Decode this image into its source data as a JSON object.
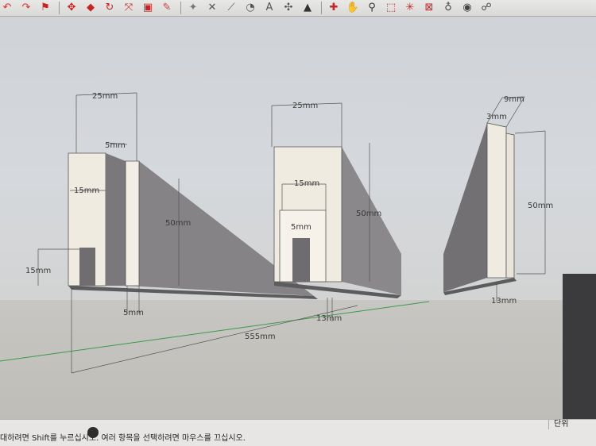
{
  "toolbar": {
    "icons": [
      "undo-arc-icon",
      "redo-arc-icon",
      "flag-icon",
      "move-icon",
      "pushpull-icon",
      "rotate-icon",
      "scale-icon",
      "offset-icon",
      "eraser-icon",
      "paint-icon",
      "tape-measure-icon",
      "dimension-icon",
      "protractor-icon",
      "text-icon",
      "axes-icon",
      "section-icon",
      "orbit-icon",
      "pan-icon",
      "zoom-icon",
      "zoom-window-icon",
      "zoom-extents-icon",
      "previous-view-icon",
      "position-camera-icon",
      "look-around-icon",
      "walk-icon",
      "footprints-icon"
    ]
  },
  "dimensions": {
    "left_width": "25mm",
    "left_gap": "5mm",
    "left_inner": "15mm",
    "left_height": "50mm",
    "left_slot": "15mm",
    "left_bottom": "5mm",
    "mid_width": "25mm",
    "mid_inner": "15mm",
    "mid_height": "50mm",
    "mid_slot": "5mm",
    "mid_bottom": "13mm",
    "right_top": "9mm",
    "right_small": "3mm",
    "right_height": "50mm",
    "right_bottom": "13mm",
    "total_length": "555mm"
  },
  "status": {
    "message": "대하려면 Shift를 누르십시오. 여러 항목을 선택하려면 마우스를 끄십시오.",
    "unit_label": "단위"
  },
  "colors": {
    "face_light": "#f0ebe1",
    "face_shadow": "#807e80",
    "dimension_line": "#555555"
  }
}
